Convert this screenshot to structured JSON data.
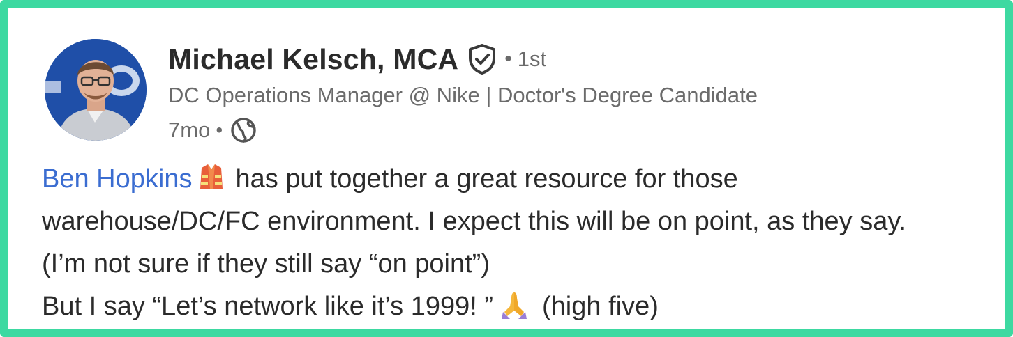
{
  "author": {
    "name": "Michael Kelsch, MCA",
    "connection_separator": "•",
    "connection_degree": "1st",
    "headline": "DC Operations Manager @ Nike | Doctor's Degree Candidate",
    "time_ago": "7mo",
    "meta_separator": "•",
    "verified_icon": "shield-check-icon",
    "visibility_icon": "globe-icon"
  },
  "post": {
    "mention": "Ben Hopkins",
    "mention_emoji": "safety-vest-emoji",
    "line1_rest": "has put together a great resource for those",
    "line2": "warehouse/DC/FC environment. I expect this will be on point, as they say.",
    "line3": "(I’m not sure if they still say “on point”)",
    "line4_start": "But I say “Let’s network like it’s 1999! ”",
    "line4_emoji": "folded-hands-emoji",
    "line4_end": "(high five)"
  },
  "colors": {
    "frame_border": "#3dd9a1",
    "mention_link": "#3b6dd1",
    "primary_text": "#2b2b2b",
    "secondary_text": "#6b6b6b"
  }
}
